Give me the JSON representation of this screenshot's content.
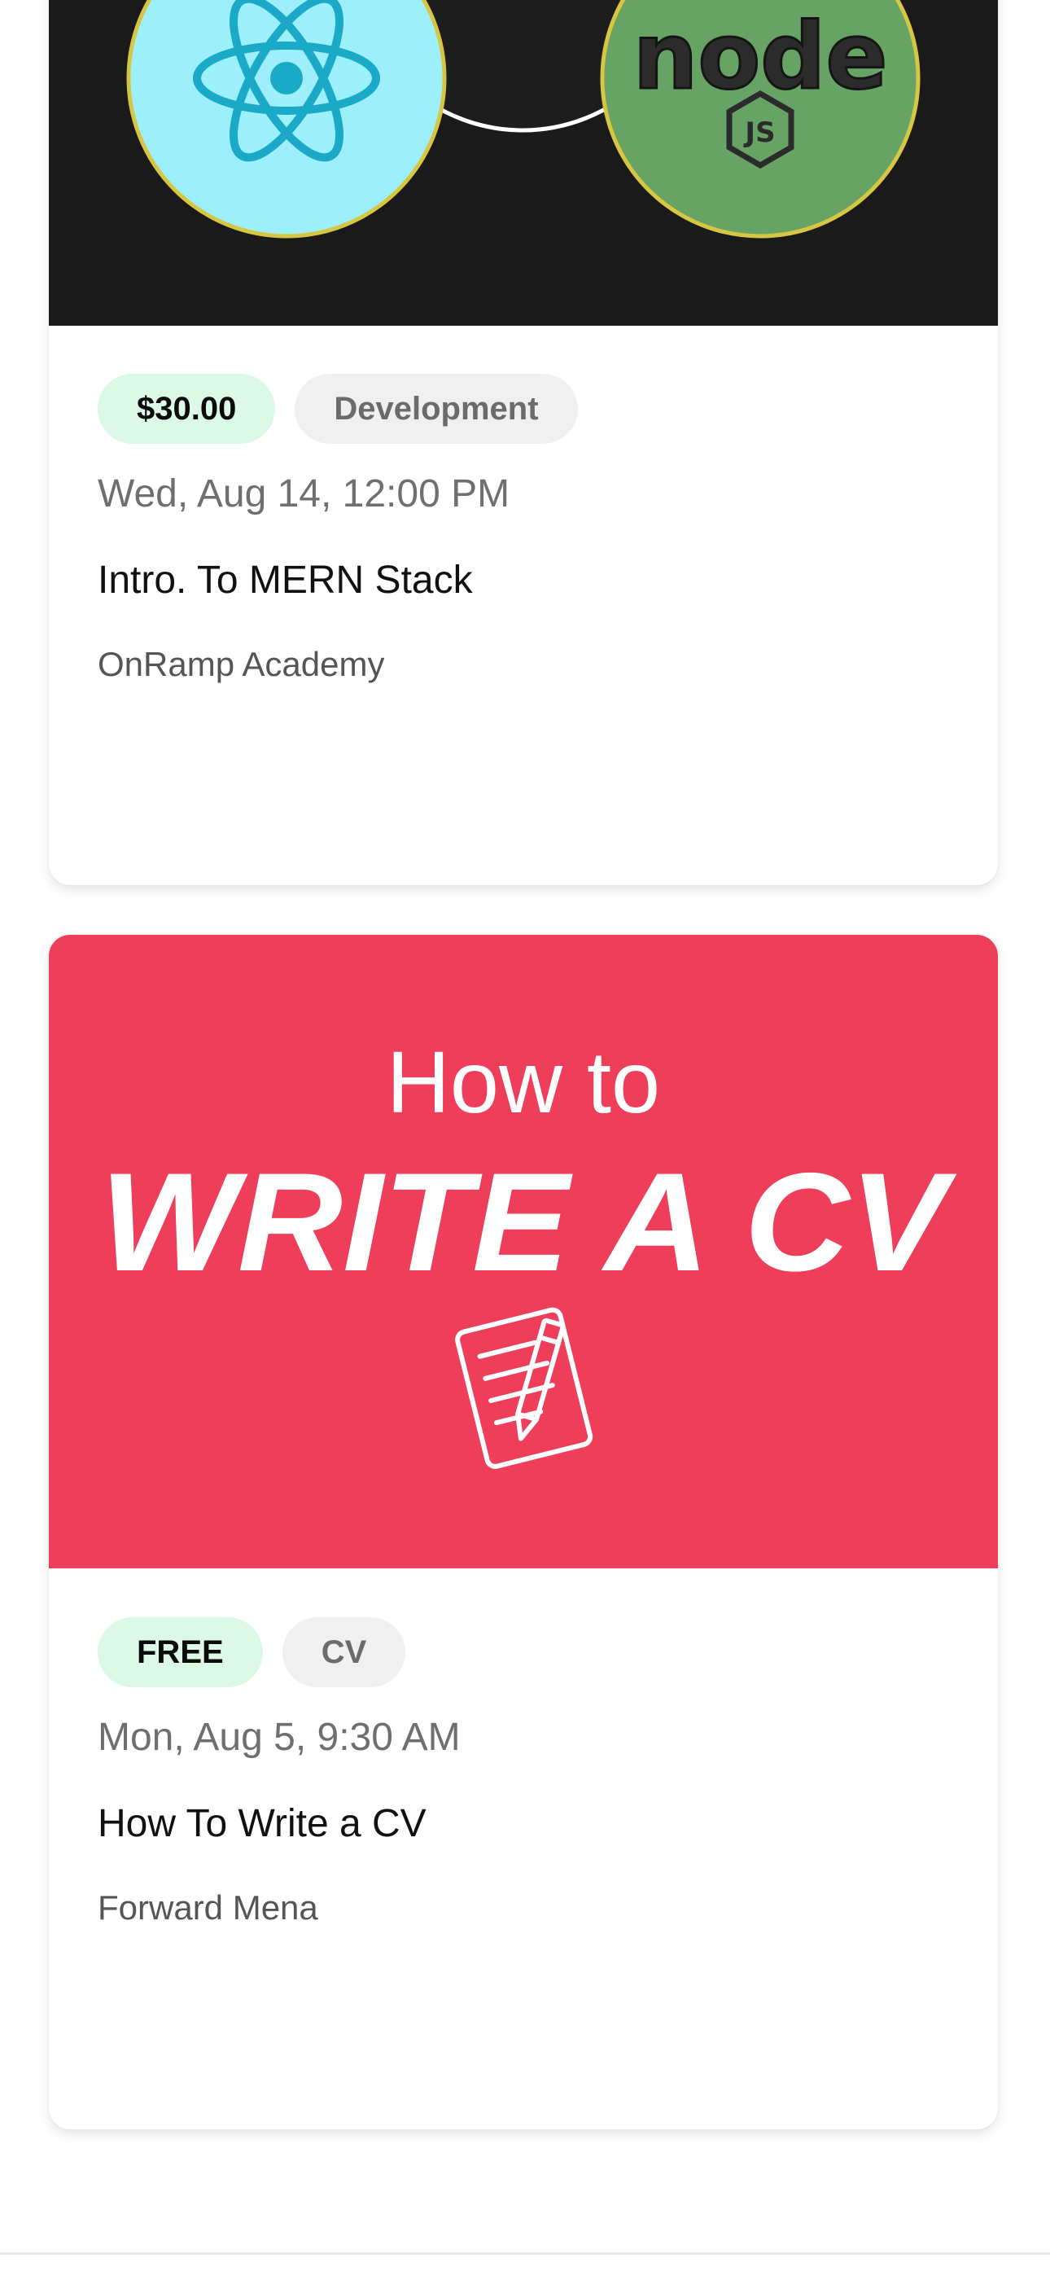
{
  "events": [
    {
      "price": "$30.00",
      "category": "Development",
      "date": "Wed, Aug 14, 12:00 PM",
      "title": "Intro. To MERN Stack",
      "organizer": "OnRamp Academy",
      "banner": {
        "logos": [
          "react-logo",
          "node-js-logo"
        ],
        "logo_text": "node",
        "logo_badge": "JS"
      }
    },
    {
      "price": "FREE",
      "category": "CV",
      "date": "Mon, Aug 5, 9:30 AM",
      "title": "How To Write a CV",
      "organizer": "Forward Mena",
      "banner": {
        "line1": "How to",
        "line2": "WRITE A CV",
        "icon": "document-pencil-icon",
        "background": "#ee3e5a"
      }
    }
  ],
  "colors": {
    "price_tag_bg": "#dcf8e6",
    "category_tag_bg": "#f0f0f0",
    "card1_banner_bg": "#1a1a1a",
    "react_circle": "#9df0fb",
    "node_circle": "#67a364"
  }
}
